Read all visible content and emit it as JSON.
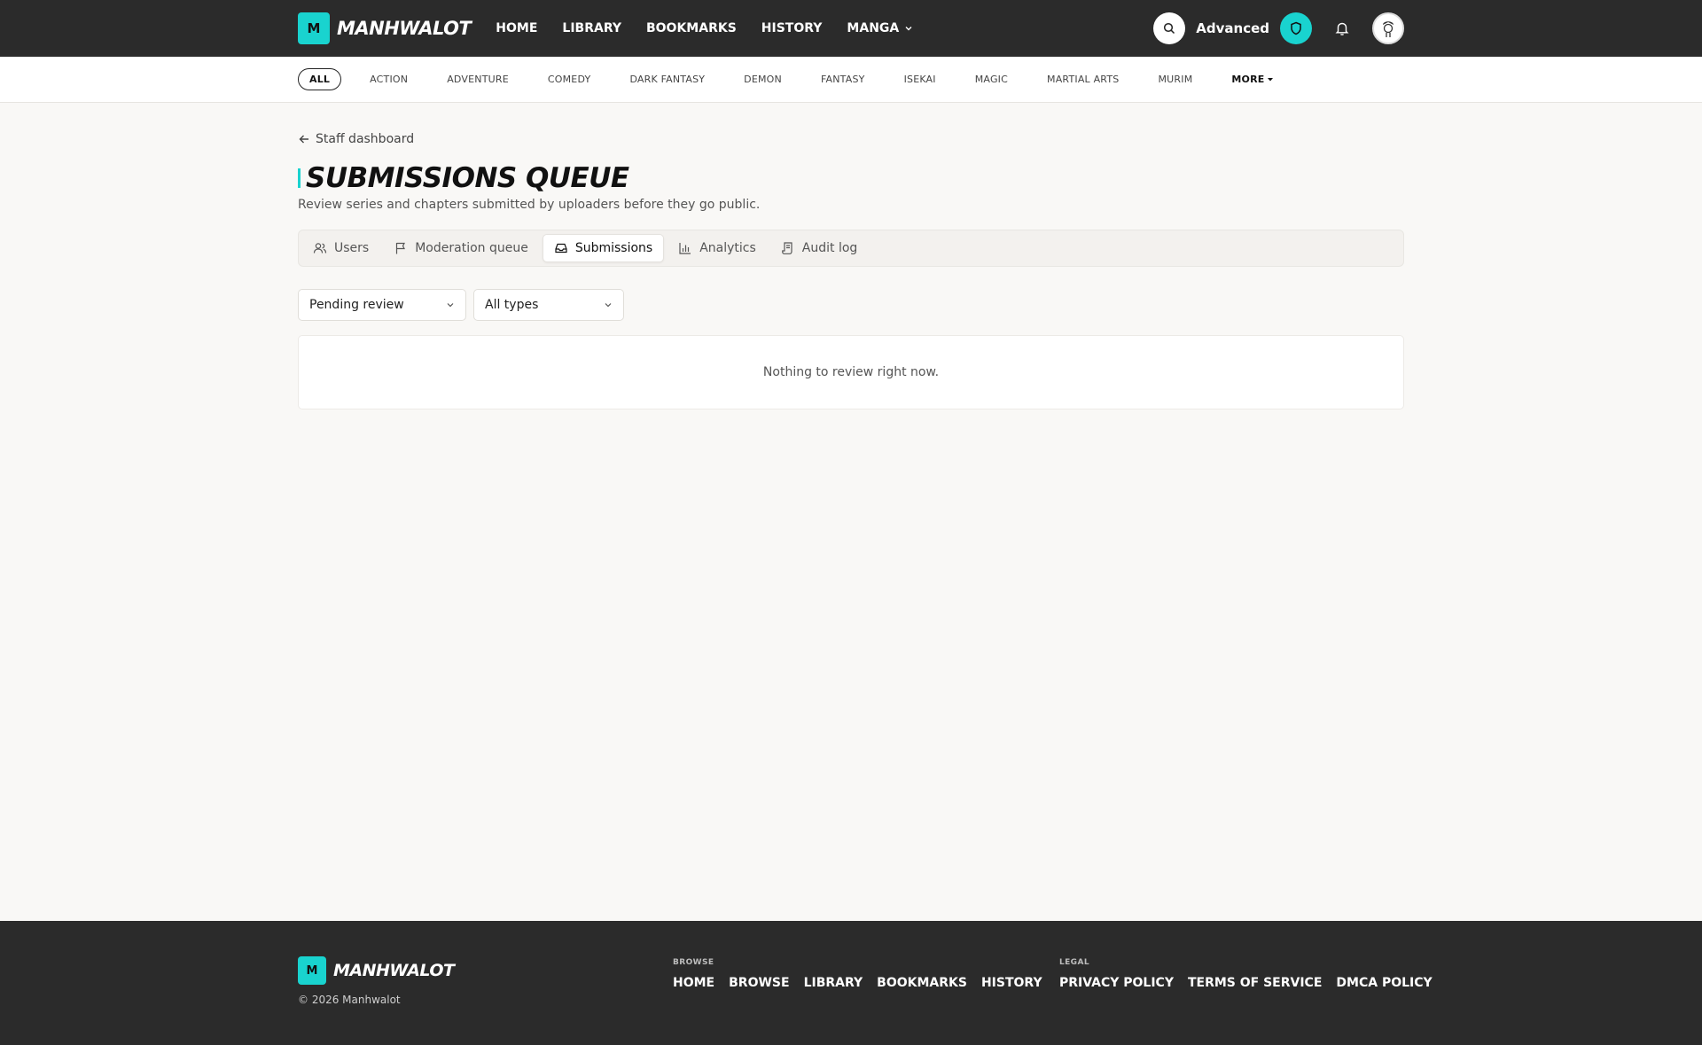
{
  "brand": {
    "logo_letter": "M",
    "name": "MANHWALOT",
    "accent_color": "#19d3cf",
    "dark_color": "#2b2b2b"
  },
  "nav": {
    "items": [
      "HOME",
      "LIBRARY",
      "BOOKMARKS",
      "HISTORY"
    ],
    "manga_label": "MANGA",
    "advanced_label": "Advanced"
  },
  "genres": {
    "items": [
      "ALL",
      "ACTION",
      "ADVENTURE",
      "COMEDY",
      "DARK FANTASY",
      "DEMON",
      "FANTASY",
      "ISEKAI",
      "MAGIC",
      "MARTIAL ARTS",
      "MURIM"
    ],
    "more_label": "MORE",
    "active": "ALL"
  },
  "page": {
    "back_label": "Staff dashboard",
    "title": "SUBMISSIONS QUEUE",
    "subtitle": "Review series and chapters submitted by uploaders before they go public."
  },
  "tabs": [
    {
      "label": "Users",
      "icon": "users-icon"
    },
    {
      "label": "Moderation queue",
      "icon": "flag-icon"
    },
    {
      "label": "Submissions",
      "icon": "inbox-icon",
      "active": true
    },
    {
      "label": "Analytics",
      "icon": "bar-chart-icon"
    },
    {
      "label": "Audit log",
      "icon": "scroll-icon"
    }
  ],
  "filters": {
    "status_value": "Pending review",
    "type_value": "All types"
  },
  "empty_message": "Nothing to review right now.",
  "footer": {
    "copyright": "© 2026 Manhwalot",
    "browse_heading": "BROWSE",
    "browse_links": [
      "HOME",
      "BROWSE",
      "LIBRARY",
      "BOOKMARKS",
      "HISTORY"
    ],
    "legal_heading": "LEGAL",
    "legal_links": [
      "PRIVACY POLICY",
      "TERMS OF SERVICE",
      "DMCA POLICY"
    ]
  }
}
